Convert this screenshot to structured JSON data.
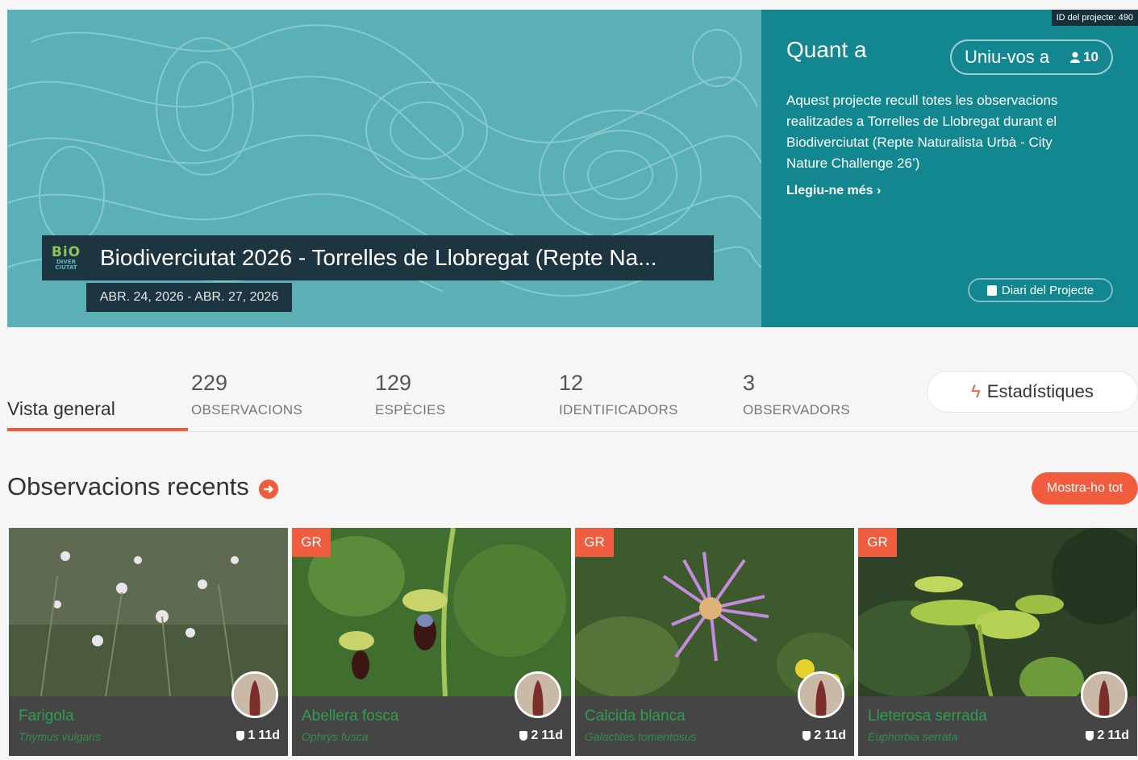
{
  "hero": {
    "logo_lines": [
      "BiO",
      "DIVER",
      "CIUTAT"
    ],
    "title": "Biodiverciutat 2026 - Torrelles de Llobregat (Repte Na...",
    "dates": "ABR. 24, 2026 - ABR. 27, 2026"
  },
  "about": {
    "project_id": "ID del projecte: 490",
    "title": "Quant a",
    "join_label": "Uniu-vos a",
    "members_count": "10",
    "description": "Aquest projecte recull totes les observacions realitzades a Torrelles de Llobregat durant el Biodiverciutat (Repte Naturalista Urbà - City Nature Challenge 26’)",
    "read_more": "Llegiu-ne més ›",
    "journal_label": "Diari del Projecte"
  },
  "tabs": {
    "overview_label": "Vista general",
    "stats": [
      {
        "value": "229",
        "label": "OBSERVACIONS"
      },
      {
        "value": "129",
        "label": "ESPÈCIES"
      },
      {
        "value": "12",
        "label": "IDENTIFICADORS"
      },
      {
        "value": "3",
        "label": "OBSERVADORS"
      }
    ],
    "stats_button": "Estadístiques"
  },
  "recent": {
    "title": "Observacions recents",
    "show_all": "Mostra-ho tot",
    "cards": [
      {
        "grade": "",
        "common_name": "Farigola",
        "scientific_name": "Thymus vulgaris",
        "ids": "1",
        "age": "11d"
      },
      {
        "grade": "GR",
        "common_name": "Abellera fosca",
        "scientific_name": "Ophrys fusca",
        "ids": "2",
        "age": "11d"
      },
      {
        "grade": "GR",
        "common_name": "Calcida blanca",
        "scientific_name": "Galactites tomentosus",
        "ids": "2",
        "age": "11d"
      },
      {
        "grade": "GR",
        "common_name": "Lleterosa serrada",
        "scientific_name": "Euphorbia serrata",
        "ids": "2",
        "age": "11d"
      }
    ]
  },
  "colors": {
    "accent": "#ef5d3e",
    "teal": "#138790",
    "banner": "#5bb0b6",
    "dark": "#1c3540"
  },
  "icons": [
    "user-icon",
    "journal-icon",
    "lightning-icon",
    "arrow-right-circle-icon",
    "identification-shield-icon"
  ]
}
